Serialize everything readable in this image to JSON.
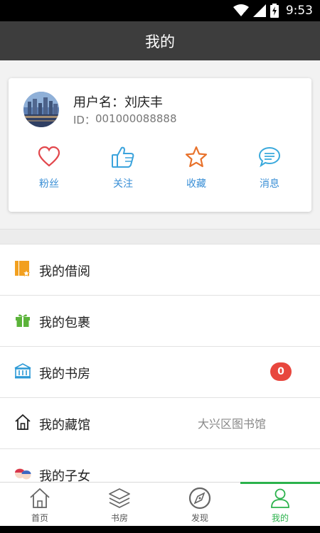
{
  "status_bar": {
    "time": "9:53",
    "icons": [
      "wifi-icon",
      "signal-icon",
      "battery-charging-icon"
    ]
  },
  "header": {
    "title": "我的"
  },
  "profile": {
    "username_label": "用户名：",
    "username": "刘庆丰",
    "id_label": "ID：",
    "id": "001000088888",
    "stats": [
      {
        "label": "粉丝",
        "icon": "heart-icon"
      },
      {
        "label": "关注",
        "icon": "thumbs-up-icon"
      },
      {
        "label": "收藏",
        "icon": "star-icon"
      },
      {
        "label": "消息",
        "icon": "message-icon"
      }
    ]
  },
  "menu": {
    "items": [
      {
        "label": "我的借阅",
        "icon": "book-borrow-icon"
      },
      {
        "label": "我的包裹",
        "icon": "gift-icon"
      },
      {
        "label": "我的书房",
        "icon": "library-icon",
        "badge": "0"
      },
      {
        "label": "我的藏馆",
        "icon": "home-icon",
        "value": "大兴区图书馆"
      },
      {
        "label": "我的子女",
        "icon": "children-icon"
      }
    ]
  },
  "bottom_nav": {
    "items": [
      {
        "label": "首页",
        "icon": "home-outline-icon"
      },
      {
        "label": "书房",
        "icon": "layers-icon"
      },
      {
        "label": "发现",
        "icon": "compass-icon"
      },
      {
        "label": "我的",
        "icon": "user-icon",
        "active": true
      }
    ]
  },
  "colors": {
    "header_bg": "#3d3d3d",
    "accent_green": "#2bb24c",
    "stat_label_blue": "#3a8fd6",
    "badge_red": "#e8473e",
    "heart_red": "#e2474c",
    "thumb_blue": "#3ba3dc",
    "star_orange": "#e8722c",
    "message_blue": "#3aa9dc"
  }
}
